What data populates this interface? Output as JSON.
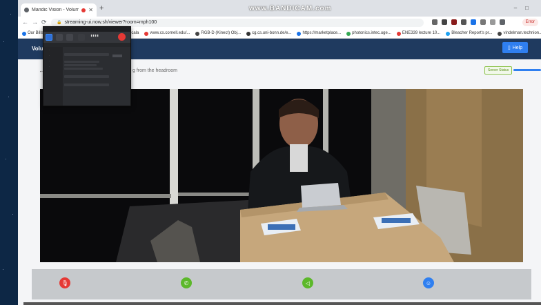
{
  "browser": {
    "tab_title": "Mandic Vision - Volumetric",
    "new_tab": "+",
    "watermark": "www.BANDICAM.com",
    "url": "streaming-ui.now.sh/viewer?room=mph100",
    "profile_label": "Error",
    "bookmarks": [
      "Our Bills",
      "Mancala",
      "www.cs.cornell.edu/...",
      "RGB-D (Kinect) Obj...",
      "cg.cs.uni-bonn.de/e...",
      "https://marketplace...",
      "photonics.intec.uge...",
      "ENE339 lecture 10...",
      "Bleacher Report's pr...",
      "vindelman.technion..."
    ]
  },
  "app": {
    "brand": "Volu",
    "help_label": "Help",
    "subtitle": "g from the headroom",
    "server_status": "Server Status"
  },
  "controls": [
    {
      "name": "mic-mute",
      "color": "#e53935",
      "icon": "mic-off-icon"
    },
    {
      "name": "call",
      "color": "#5cb82a",
      "icon": "phone-icon"
    },
    {
      "name": "volume",
      "color": "#5cb82a",
      "icon": "speaker-icon"
    },
    {
      "name": "user",
      "color": "#2f7ff0",
      "icon": "user-icon"
    }
  ]
}
